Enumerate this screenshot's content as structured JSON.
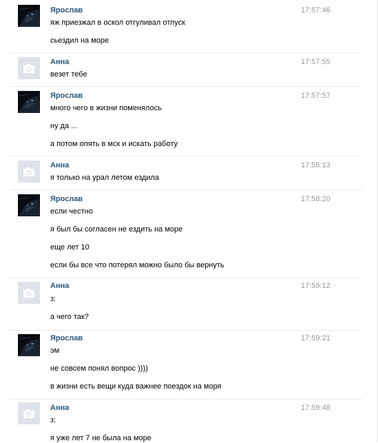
{
  "messages": [
    {
      "author": "Ярослав",
      "avatar_icon": "user-photo-icon",
      "time": "17:57:46",
      "lines": [
        "яж приезжал в оскол отгуливал отпуск",
        "сьездил на море"
      ]
    },
    {
      "author": "Анна",
      "avatar_icon": "camera-placeholder-icon",
      "time": "17:57:55",
      "lines": [
        "везет тебе"
      ]
    },
    {
      "author": "Ярослав",
      "avatar_icon": "user-photo-icon",
      "time": "17:57:57",
      "lines": [
        "много чего в жизни поменялось",
        "ну да ...",
        "а потом опять в мск и искать работу"
      ]
    },
    {
      "author": "Анна",
      "avatar_icon": "camera-placeholder-icon",
      "time": "17:58:13",
      "lines": [
        "я только на урал летом ездила"
      ]
    },
    {
      "author": "Ярослав",
      "avatar_icon": "user-photo-icon",
      "time": "17:58:20",
      "lines": [
        "если честно",
        "я был бы согласен не ездить на море",
        "еще лет 10",
        "если бы все что потерял можно было бы вернуть"
      ]
    },
    {
      "author": "Анна",
      "avatar_icon": "camera-placeholder-icon",
      "time": "17:59:12",
      "lines": [
        "з:",
        "а чего так?"
      ]
    },
    {
      "author": "Ярослав",
      "avatar_icon": "user-photo-icon",
      "time": "17:59:21",
      "lines": [
        "эм",
        "не совсем понял вопрос ))))",
        "в жизни есть вещи куда важнее поездок на моря"
      ]
    },
    {
      "author": "Анна",
      "avatar_icon": "camera-placeholder-icon",
      "time": "17:59:48",
      "lines": [
        "з:",
        "я уже лет 7 не была на море"
      ]
    }
  ],
  "colors": {
    "author": "#2b587a",
    "time": "#999999",
    "text": "#000000",
    "divider": "#e7ebf0",
    "placeholder_bg": "#dde3ea"
  }
}
